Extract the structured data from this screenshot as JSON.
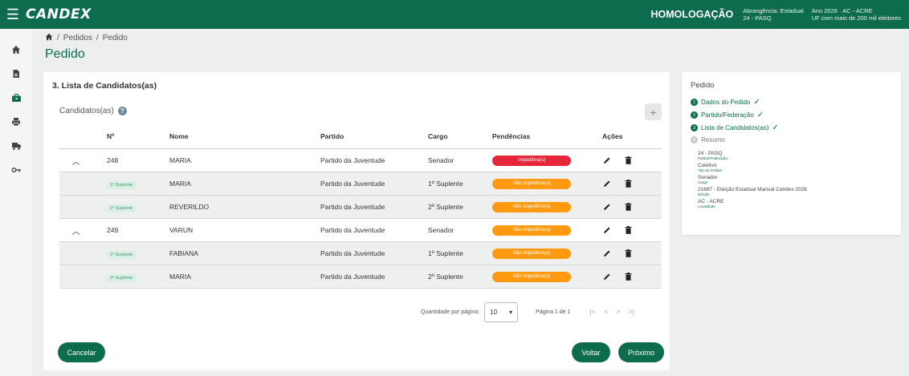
{
  "header": {
    "logo": "CANDEX",
    "environment": "HOMOLOGAÇÃO",
    "abrangencia": "Abrangência: Estadual",
    "pasq": "24 - PASQ",
    "ano": "Ano 2026 · AC - ACRE",
    "uf": "UF com mais de 200 mil eleitores",
    "brand_color": "#0d6b4e"
  },
  "rail": {
    "icons": [
      "home-icon",
      "document-icon",
      "briefcase-icon",
      "printer-icon",
      "trucks-icon",
      "key-icon"
    ]
  },
  "breadcrumb": {
    "home_icon": "home-icon",
    "items": [
      "Pedidos",
      "Pedido"
    ],
    "separator": "/"
  },
  "page": {
    "title": "Pedido"
  },
  "section": {
    "title": "3. Lista de Candidatos(as)",
    "candidates_label": "Candidatos(as)",
    "help_glyph": "?",
    "add_glyph": "+"
  },
  "table": {
    "headers": [
      "Nº",
      "Nome",
      "Partido",
      "Cargo",
      "Pendências",
      "Ações"
    ],
    "rows": [
      {
        "num": "248",
        "name": "MARIA",
        "party": "Partido da Juventude",
        "role": "Senador",
        "status": "Impeditiva(s)"
      },
      {
        "badge": "1º Suplente",
        "name": "MARIA",
        "party": "Partido da Juventude",
        "role": "1º Suplente",
        "status": "Não impeditiva(s)"
      },
      {
        "badge": "2º Suplente",
        "name": "REVERILDO",
        "party": "Partido da Juventude",
        "role": "2º Suplente",
        "status": "Não impeditiva(s)"
      },
      {
        "num": "249",
        "name": "VARUN",
        "party": "Partido da Juventude",
        "role": "Senador",
        "status": "Não impeditiva(s)"
      },
      {
        "badge": "1º Suplente",
        "name": "FABIANA",
        "party": "Partido da Juventude",
        "role": "1º Suplente",
        "status": "Não impeditiva(s)"
      },
      {
        "badge": "2º Suplente",
        "name": "MARIA",
        "party": "Partido da Juventude",
        "role": "2º Suplente",
        "status": "Não impeditiva(s)"
      }
    ],
    "status_colors": {
      "impeditiva": "#e8263a",
      "nao_impeditiva": "#ff9a10"
    }
  },
  "pagination": {
    "label": "Quantidade por página:",
    "page_size": "10",
    "page_info": "Página 1 de 1",
    "first": "|<",
    "prev": "<",
    "next": ">",
    "last": ">|"
  },
  "buttons": {
    "cancel": "Cancelar",
    "back": "Voltar",
    "next": "Próximo"
  },
  "sidebar": {
    "title": "Pedido",
    "steps": [
      {
        "num": "1",
        "label": "Dados do Pedido",
        "done": true
      },
      {
        "num": "2",
        "label": "Partido/Federação",
        "done": true
      },
      {
        "num": "3",
        "label": "Lista de Candidatos(as)",
        "done": true
      },
      {
        "num": "4",
        "label": "Resumo",
        "done": false
      }
    ],
    "check_glyph": "✓",
    "summary": [
      {
        "value": "24 - PASQ",
        "label": "Partido/Federação"
      },
      {
        "value": "Coletivo",
        "label": "Tipo do Pedido"
      },
      {
        "value": "Senador",
        "label": "Cargo"
      },
      {
        "value": "21687 - Eleição Estadual Manual Candex 2026",
        "label": "Eleição"
      },
      {
        "value": "AC - ACRE",
        "label": "Localidade"
      }
    ]
  }
}
